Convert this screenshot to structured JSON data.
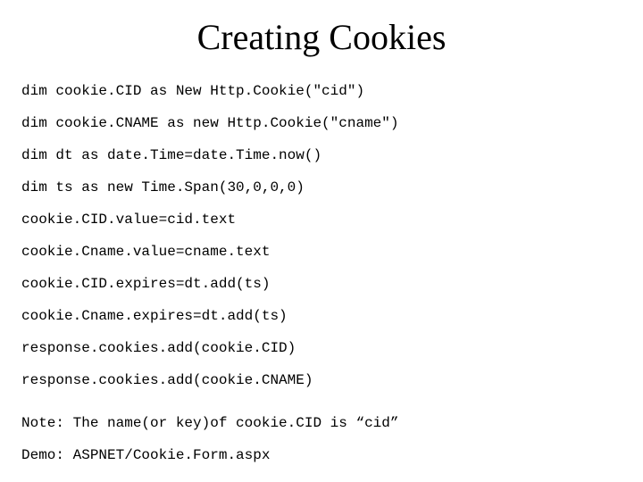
{
  "title": "Creating Cookies",
  "code": [
    "dim cookie.CID as New Http.Cookie(\"cid\")",
    "dim cookie.CNAME as new Http.Cookie(\"cname\")",
    "dim dt as date.Time=date.Time.now()",
    "dim ts as new Time.Span(30,0,0,0)",
    "cookie.CID.value=cid.text",
    "cookie.Cname.value=cname.text",
    "cookie.CID.expires=dt.add(ts)",
    "cookie.Cname.expires=dt.add(ts)",
    "response.cookies.add(cookie.CID)",
    "response.cookies.add(cookie.CNAME)"
  ],
  "notes": [
    "Note: The name(or key)of cookie.CID is “cid”",
    "Demo: ASPNET/Cookie.Form.aspx"
  ]
}
